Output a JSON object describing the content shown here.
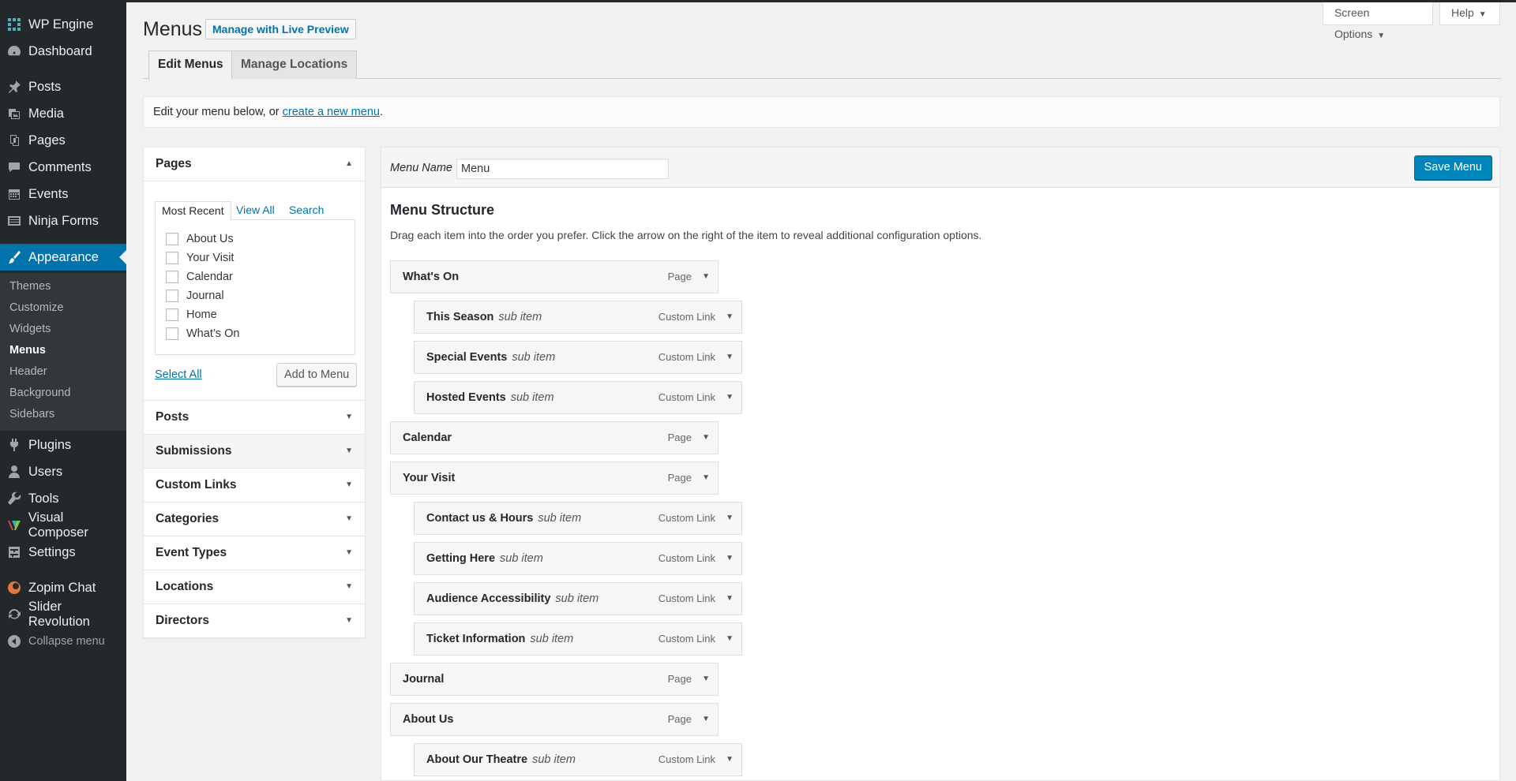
{
  "sidebar": {
    "items": [
      {
        "label": "WP Engine",
        "icon": "wp-engine-icon"
      },
      {
        "label": "Dashboard",
        "icon": "dashboard-icon"
      },
      {
        "label": "Posts",
        "icon": "pin-icon"
      },
      {
        "label": "Media",
        "icon": "media-icon"
      },
      {
        "label": "Pages",
        "icon": "pages-icon"
      },
      {
        "label": "Comments",
        "icon": "comments-icon"
      },
      {
        "label": "Events",
        "icon": "calendar-icon"
      },
      {
        "label": "Ninja Forms",
        "icon": "forms-icon"
      },
      {
        "label": "Appearance",
        "icon": "brush-icon"
      },
      {
        "label": "Plugins",
        "icon": "plug-icon"
      },
      {
        "label": "Users",
        "icon": "user-icon"
      },
      {
        "label": "Tools",
        "icon": "wrench-icon"
      },
      {
        "label": "Visual Composer",
        "icon": "vc-icon"
      },
      {
        "label": "Settings",
        "icon": "settings-icon"
      },
      {
        "label": "Zopim Chat",
        "icon": "chat-icon"
      },
      {
        "label": "Slider Revolution",
        "icon": "refresh-icon"
      },
      {
        "label": "Collapse menu",
        "icon": "collapse-icon"
      }
    ],
    "submenu": [
      "Themes",
      "Customize",
      "Widgets",
      "Menus",
      "Header",
      "Background",
      "Sidebars"
    ]
  },
  "header": {
    "title": "Menus",
    "live_preview": "Manage with Live Preview",
    "screen_options": "Screen Options",
    "help": "Help",
    "tabs": [
      "Edit Menus",
      "Manage Locations"
    ]
  },
  "notice": {
    "prefix": "Edit your menu below, or ",
    "link": "create a new menu",
    "suffix": "."
  },
  "accordion": {
    "pages_title": "Pages",
    "inner_tabs": [
      "Most Recent",
      "View All",
      "Search"
    ],
    "pages": [
      "About Us",
      "Your Visit",
      "Calendar",
      "Journal",
      "Home",
      "What’s On"
    ],
    "select_all": "Select All",
    "add_to_menu": "Add to Menu",
    "sections": [
      "Posts",
      "Submissions",
      "Custom Links",
      "Categories",
      "Event Types",
      "Locations",
      "Directors"
    ]
  },
  "menu": {
    "name_label": "Menu Name",
    "name_value": "Menu",
    "save": "Save Menu",
    "structure_title": "Menu Structure",
    "structure_desc": "Drag each item into the order you prefer. Click the arrow on the right of the item to reveal additional configuration options.",
    "sub_tag": "sub item",
    "items": [
      {
        "title": "What's On",
        "type": "Page",
        "level": 0
      },
      {
        "title": "This Season",
        "type": "Custom Link",
        "level": 1
      },
      {
        "title": "Special Events",
        "type": "Custom Link",
        "level": 1
      },
      {
        "title": "Hosted Events",
        "type": "Custom Link",
        "level": 1
      },
      {
        "title": "Calendar",
        "type": "Page",
        "level": 0
      },
      {
        "title": "Your Visit",
        "type": "Page",
        "level": 0
      },
      {
        "title": "Contact us & Hours",
        "type": "Custom Link",
        "level": 1
      },
      {
        "title": "Getting Here",
        "type": "Custom Link",
        "level": 1
      },
      {
        "title": "Audience Accessibility",
        "type": "Custom Link",
        "level": 1
      },
      {
        "title": "Ticket Information",
        "type": "Custom Link",
        "level": 1
      },
      {
        "title": "Journal",
        "type": "Page",
        "level": 0
      },
      {
        "title": "About Us",
        "type": "Page",
        "level": 0
      },
      {
        "title": "About Our Theatre",
        "type": "Custom Link",
        "level": 1
      }
    ]
  },
  "colors": {
    "sidebar_bg": "#23282d",
    "submenu_bg": "#32373c",
    "accent": "#0073aa",
    "primary_button": "#0085ba"
  }
}
